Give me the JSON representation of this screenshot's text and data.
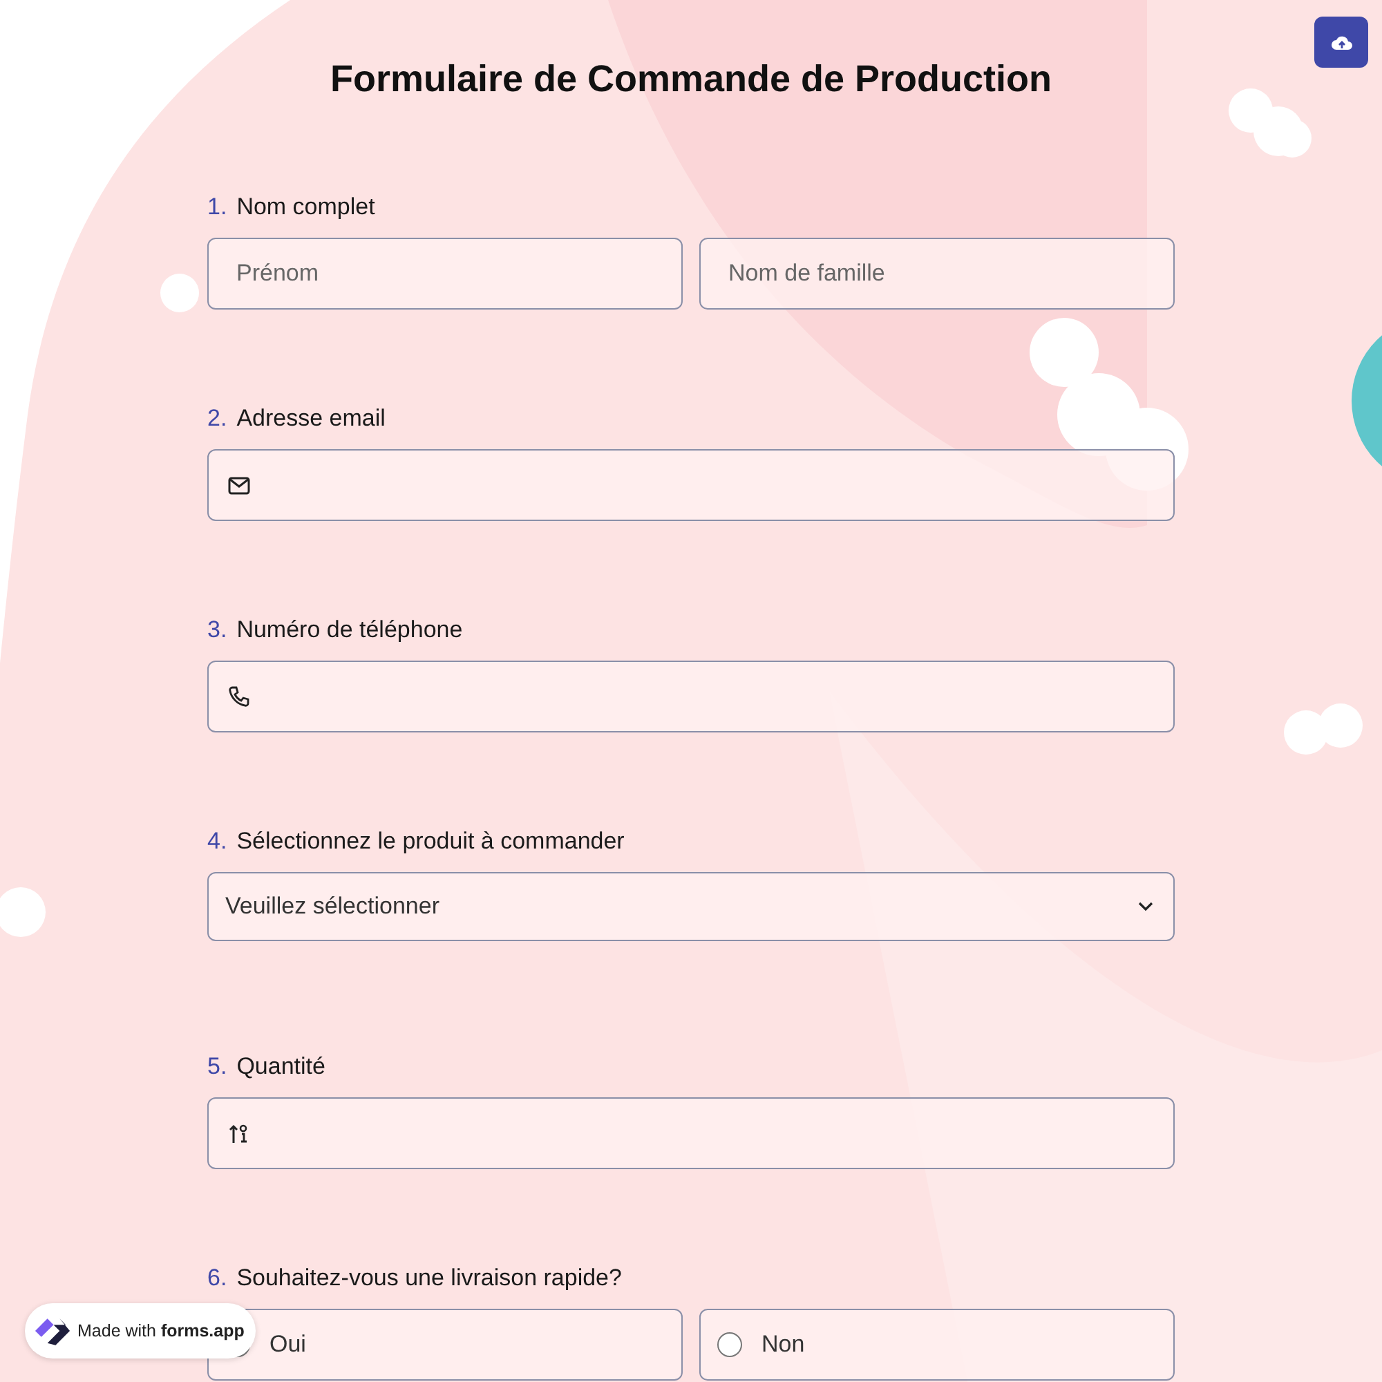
{
  "title": "Formulaire de Commande de Production",
  "questions": [
    {
      "number": "1.",
      "label": "Nom complet",
      "kind": "name",
      "fields": [
        {
          "placeholder": "Prénom"
        },
        {
          "placeholder": "Nom de famille"
        }
      ]
    },
    {
      "number": "2.",
      "label": "Adresse email",
      "kind": "email"
    },
    {
      "number": "3.",
      "label": "Numéro de téléphone",
      "kind": "phone"
    },
    {
      "number": "4.",
      "label": "Sélectionnez le produit à commander",
      "kind": "select",
      "value": "Veuillez sélectionner"
    },
    {
      "number": "5.",
      "label": "Quantité",
      "kind": "number"
    },
    {
      "number": "6.",
      "label": "Souhaitez-vous une livraison rapide?",
      "kind": "radio",
      "options": [
        {
          "label": "Oui",
          "selected": false
        },
        {
          "label": "Non",
          "selected": false
        }
      ]
    }
  ],
  "badge": "Made with **forms.app**"
}
